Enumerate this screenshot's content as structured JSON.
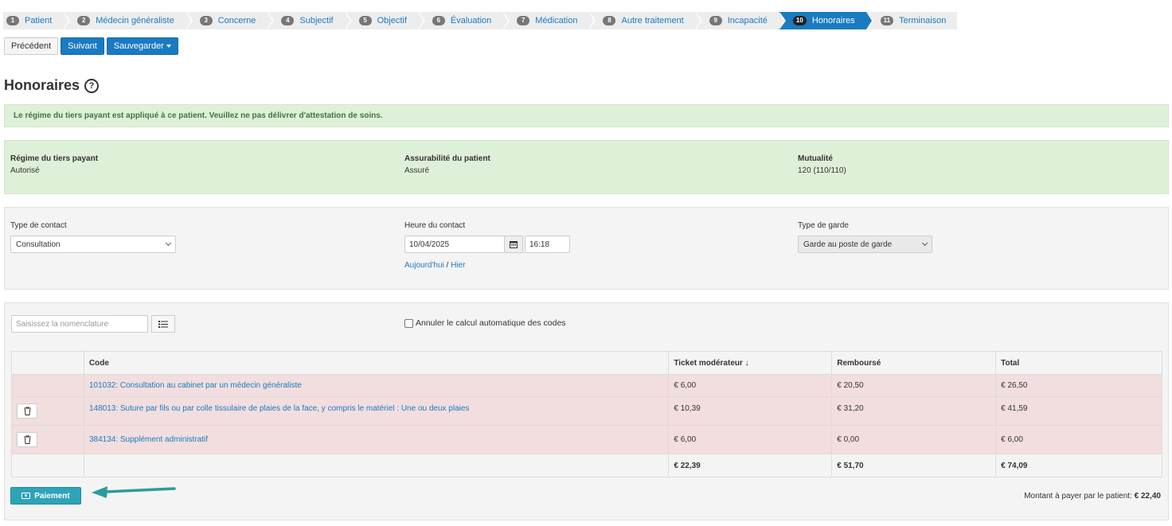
{
  "wizard": {
    "steps": [
      {
        "num": "1",
        "label": "Patient"
      },
      {
        "num": "2",
        "label": "Médecin généraliste"
      },
      {
        "num": "3",
        "label": "Concerne"
      },
      {
        "num": "4",
        "label": "Subjectif"
      },
      {
        "num": "5",
        "label": "Objectif"
      },
      {
        "num": "6",
        "label": "Évaluation"
      },
      {
        "num": "7",
        "label": "Médication"
      },
      {
        "num": "8",
        "label": "Autre traitement"
      },
      {
        "num": "9",
        "label": "Incapacité"
      },
      {
        "num": "10",
        "label": "Honoraires"
      },
      {
        "num": "11",
        "label": "Terminaison"
      }
    ],
    "active_step": "10"
  },
  "toolbar": {
    "prev_label": "Précédent",
    "next_label": "Suivant",
    "save_label": "Sauvegarder"
  },
  "page": {
    "title": "Honoraires",
    "help_icon": "?"
  },
  "alert": {
    "text": "Le régime du tiers payant est appliqué à ce patient. Veuillez ne pas délivrer d'attestation de soins."
  },
  "info": {
    "regime_label": "Régime du tiers payant",
    "regime_value": "Autorisé",
    "assur_label": "Assurabilité du patient",
    "assur_value": "Assuré",
    "mutu_label": "Mutualité",
    "mutu_value": "120 (110/110)"
  },
  "contact": {
    "type_label": "Type de contact",
    "type_value": "Consultation",
    "time_label": "Heure du contact",
    "date_value": "10/04/2025",
    "hour_value": "16:18",
    "today_link": "Aujourd'hui",
    "sep": " / ",
    "yesterday_link": "Hier",
    "garde_label": "Type de garde",
    "garde_value": "Garde au poste de garde"
  },
  "codes": {
    "search_placeholder": "Saisissez la nomenclature",
    "auto_calc_label": "Annuler le calcul automatique des codes",
    "headers": {
      "code": "Code",
      "ticket": "Ticket modérateur ↓",
      "rembourse": "Remboursé",
      "total": "Total"
    },
    "rows": [
      {
        "code": "101032: Consultation au cabinet par un médecin généraliste",
        "ticket": "€ 6,00",
        "rembourse": "€ 20,50",
        "total": "€ 26,50"
      },
      {
        "code": "148013: Suture par fils ou par colle tissulaire de plaies de la face, y compris le matériel : Une ou deux plaies",
        "ticket": "€ 10,39",
        "rembourse": "€ 31,20",
        "total": "€ 41,59"
      },
      {
        "code": "384134: Supplément administratif",
        "ticket": "€ 6,00",
        "rembourse": "€ 0,00",
        "total": "€ 6,00"
      }
    ],
    "totals": {
      "ticket": "€ 22,39",
      "rembourse": "€ 51,70",
      "total": "€ 74,09"
    }
  },
  "payment": {
    "button_label": "Paiement",
    "due_label": "Montant à payer par le patient: ",
    "due_value": "€ 22,40"
  },
  "colors": {
    "primary": "#1a7bc2",
    "success_bg": "#dff0d8",
    "danger_row": "#f2dede",
    "pay_button": "#2fa3b8",
    "arrow": "#2a9d9a"
  }
}
